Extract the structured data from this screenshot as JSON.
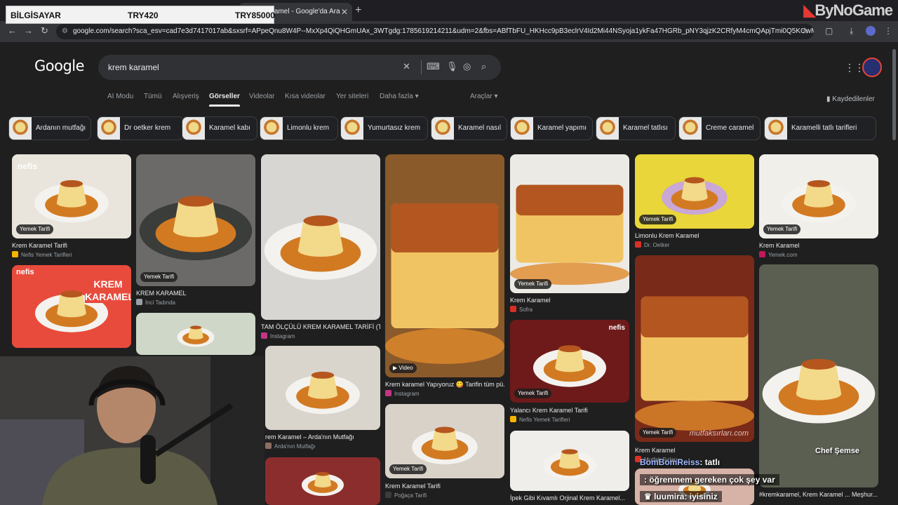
{
  "overlay": {
    "label": "BİLGİSAYAR",
    "price1": "TRY420",
    "price2": "TRY85000"
  },
  "browser": {
    "tab_title": "aramel - Google'da Ara",
    "tab_close": "✕",
    "new_tab": "+",
    "brand": "ByNoGame",
    "url": "google.com/search?sca_esv=cad7e3d7417017ab&sxsrf=APpeQnu8W4P--MxXp4QiQHGmUAx_3WTgdg:1785619214211&udm=2&fbs=ABfTbFU_HKHcc9pB3eclrV4Id2Mi44NSyoja1ykFa47HGRb_pNY3qjzK2CRfyM4cmQApjTmi0Q5KOwMYsVKHO-T2xd..."
  },
  "google": {
    "logo": "Google",
    "query": "krem karamel",
    "saved": "Kaydedilenler",
    "tabs": [
      "AI Modu",
      "Tümü",
      "Alışveriş",
      "Görseller",
      "Videolar",
      "Kısa videolar",
      "Yer siteleri",
      "Daha fazla ▾",
      "Araçlar ▾"
    ]
  },
  "chips": [
    "Ardanın mutfağı",
    "Dr oetker krem",
    "Karamel kabı",
    "Limonlu krem",
    "Yumurtasız krem",
    "Karamel nasıl",
    "Karamel yapımı",
    "Karamel tatlısı",
    "Creme caramel",
    "Karamelli tatlı tarifleri"
  ],
  "results": [
    {
      "title": "Krem Karamel Tarifi",
      "source": "Nefis Yemek Tarifleri",
      "badge": "Yemek Tarifi",
      "brand": "nefis"
    },
    {
      "title": "KREM KARAMEL",
      "source": "İnci Tadında",
      "badge": "Yemek Tarifi"
    },
    {
      "title": "TAM ÖLÇÜLÜ KREM KARAMEL TARİFİ (Tü...",
      "source": "Instagram"
    },
    {
      "title": "Krem karamel Yapıyoruz 😋 Tarifin tüm pü...",
      "source": "Instagram",
      "badge": "Video"
    },
    {
      "title": "Krem Karamel",
      "source": "Sofra",
      "badge": "Yemek Tarifi"
    },
    {
      "title": "Limonlu Krem Karamel",
      "source": "Dr. Oetker",
      "badge": "Yemek Tarifi"
    },
    {
      "title": "Krem Karamel",
      "source": "Yemek.com",
      "badge": "Yemek Tarifi"
    },
    {
      "title": "",
      "source": "",
      "brand": "nefis",
      "overlay_text": "KREM KARAMEL"
    },
    {
      "title": "rem Karamel – Arda'nın Mutfağı",
      "source": "Arda'nın Mutfağı"
    },
    {
      "title": "Yalancı Krem Karamel Tarifi",
      "source": "Nefis Yemek Tarifleri",
      "badge": "Yemek Tarifi",
      "brand": "nefis"
    },
    {
      "title": "Krem Karamel",
      "source": "Mutfak Sırları",
      "badge": "Yemek Tarifi",
      "watermark": "mutfaksırları.com"
    },
    {
      "title": "Krem Karamel Tarifi",
      "source": "Poğaça Tarifi",
      "badge": "Yemek Tarifi"
    },
    {
      "title": "İpek Gibi Kıvamlı Orjinal Krem Karamel...",
      "source": ""
    },
    {
      "title": "#kremkaramel, Krem Karamel ... Meşhur...",
      "source": "Instagram",
      "overlay_text": "Chef Şemse"
    }
  ],
  "chat": [
    {
      "user": "BomBomReiss",
      "text": ": tatlı"
    },
    {
      "user": "",
      "text": ": öğrenmem gereken çok şey var"
    },
    {
      "user": "luumira",
      "text": ": iyisiniz"
    }
  ],
  "colors": {
    "bg": "#1f1f1f",
    "accent": "#e8eaed",
    "caramel": "#c6782c",
    "custard": "#f0d98a"
  }
}
